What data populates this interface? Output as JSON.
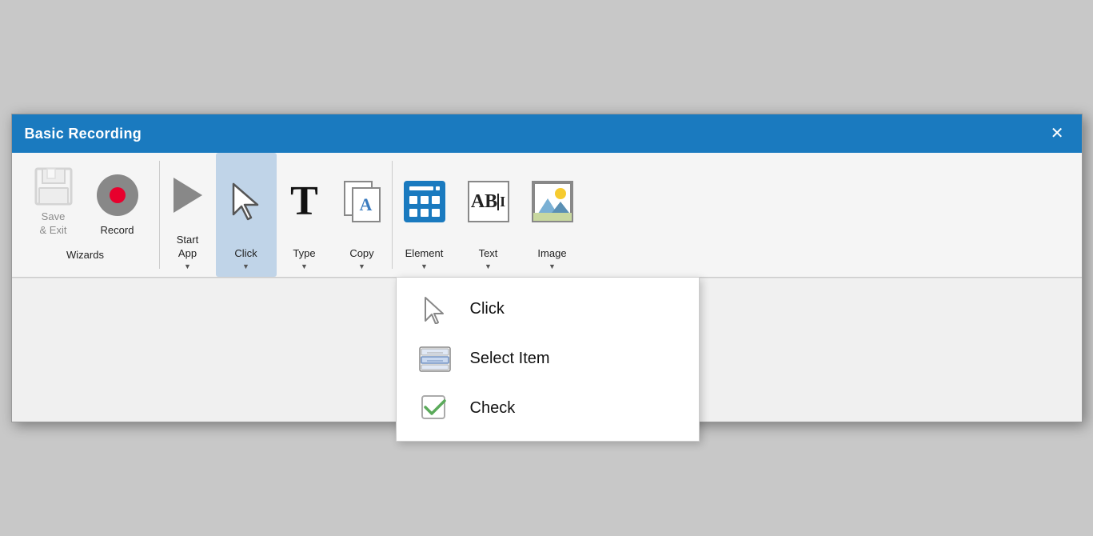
{
  "dialog": {
    "title": "Basic Recording",
    "close_label": "✕"
  },
  "toolbar": {
    "groups": {
      "wizards": {
        "label": "Wizards",
        "buttons": [
          {
            "id": "save-exit",
            "label": "Save\n& Exit",
            "icon": "save-icon",
            "has_dropdown": false,
            "disabled": true
          },
          {
            "id": "record",
            "label": "Record",
            "icon": "record-icon",
            "has_dropdown": false,
            "disabled": false
          }
        ]
      },
      "actions": {
        "buttons": [
          {
            "id": "start-app",
            "label": "Start\nApp",
            "icon": "play-icon",
            "has_dropdown": true
          },
          {
            "id": "click",
            "label": "Click",
            "icon": "cursor-icon",
            "has_dropdown": true,
            "active": true
          },
          {
            "id": "type",
            "label": "Type",
            "icon": "type-icon",
            "has_dropdown": true
          },
          {
            "id": "copy",
            "label": "Copy",
            "icon": "copy-icon",
            "has_dropdown": true
          },
          {
            "id": "element",
            "label": "Element",
            "icon": "element-icon",
            "has_dropdown": true
          },
          {
            "id": "text",
            "label": "Text",
            "icon": "text-icon",
            "has_dropdown": true
          },
          {
            "id": "image",
            "label": "Image",
            "icon": "image-icon",
            "has_dropdown": true
          }
        ]
      }
    }
  },
  "dropdown": {
    "items": [
      {
        "id": "click-item",
        "label": "Click",
        "icon": "cursor-icon"
      },
      {
        "id": "select-item",
        "label": "Select Item",
        "icon": "select-icon"
      },
      {
        "id": "check-item",
        "label": "Check",
        "icon": "check-icon"
      }
    ]
  }
}
